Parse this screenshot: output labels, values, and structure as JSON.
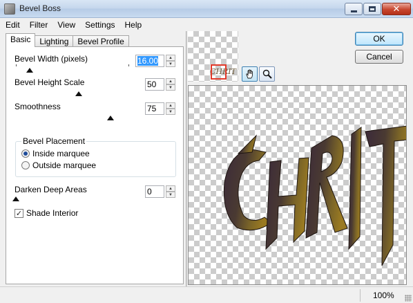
{
  "window": {
    "title": "Bevel Boss"
  },
  "menu": [
    "Edit",
    "Filter",
    "View",
    "Settings",
    "Help"
  ],
  "tabs": [
    {
      "label": "Basic",
      "active": true
    },
    {
      "label": "Lighting"
    },
    {
      "label": "Bevel Profile"
    }
  ],
  "basic": {
    "bevel_width": {
      "label": "Bevel Width (pixels)",
      "value": "16.00",
      "fraction": 0.12
    },
    "bevel_height": {
      "label": "Bevel Height Scale",
      "value": "50",
      "fraction": 0.5
    },
    "smoothness": {
      "label": "Smoothness",
      "value": "75",
      "fraction": 0.75
    },
    "placement": {
      "title": "Bevel Placement",
      "inside": {
        "label": "Inside marquee",
        "selected": true
      },
      "outside": {
        "label": "Outside marquee",
        "selected": false
      }
    },
    "darken": {
      "label": "Darken Deep Areas",
      "value": "0",
      "fraction": 0
    },
    "shade_interior": {
      "label": "Shade Interior",
      "checked": true
    }
  },
  "buttons": {
    "ok": "OK",
    "cancel": "Cancel"
  },
  "tools": [
    "hand-icon",
    "zoom-icon"
  ],
  "preview_text": "CHRIT",
  "status": {
    "zoom": "100%"
  }
}
